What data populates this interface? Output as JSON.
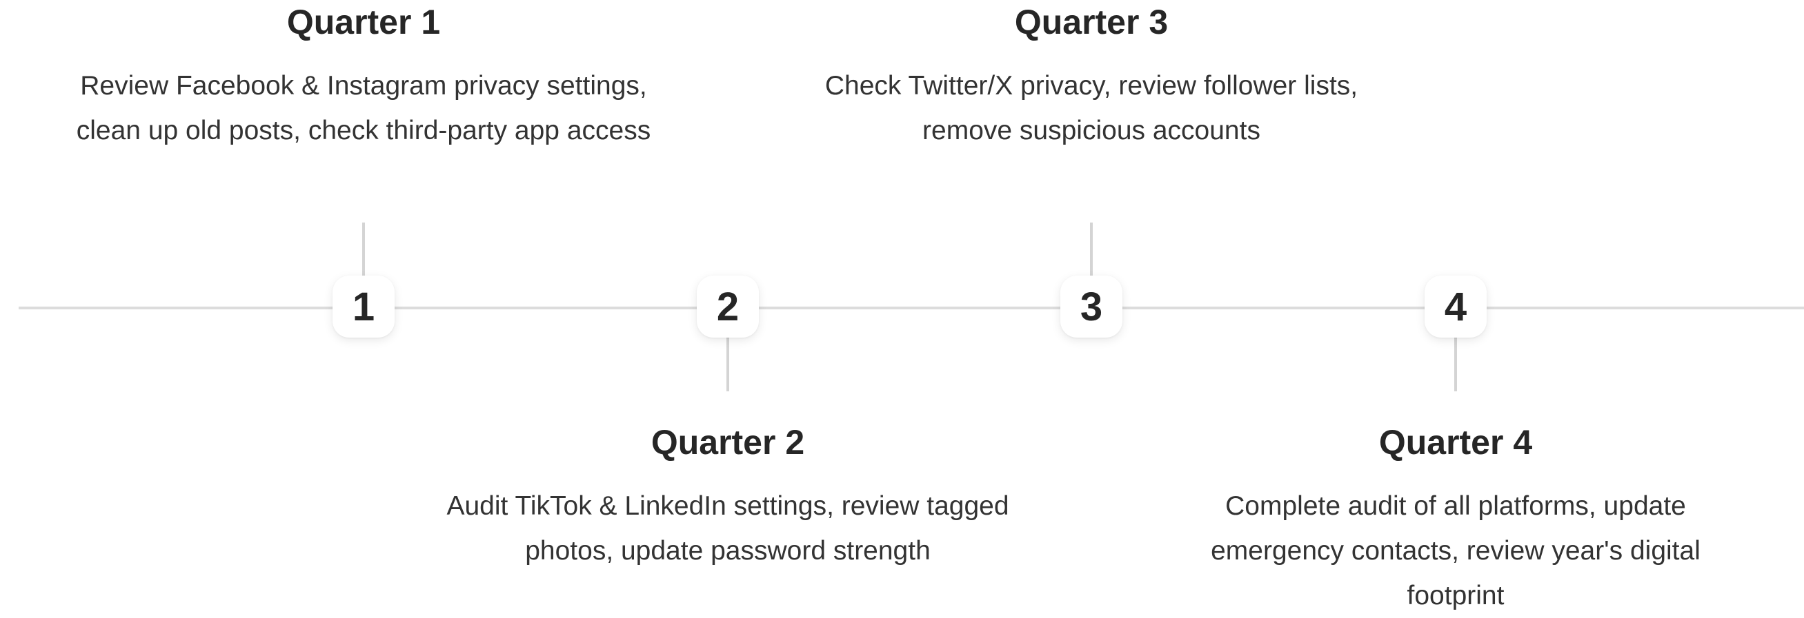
{
  "timeline": {
    "items": [
      {
        "number": "1",
        "title": "Quarter 1",
        "description": "Review Facebook & Instagram privacy settings, clean up old posts, check third-party app access"
      },
      {
        "number": "2",
        "title": "Quarter 2",
        "description": "Audit TikTok & LinkedIn settings, review tagged photos, update password strength"
      },
      {
        "number": "3",
        "title": "Quarter 3",
        "description": "Check Twitter/X privacy, review follower lists, remove suspicious accounts"
      },
      {
        "number": "4",
        "title": "Quarter 4",
        "description": "Complete audit of all platforms, update emergency contacts, review year's digital footprint"
      }
    ]
  },
  "colors": {
    "line": "#dcdcdc",
    "text": "#262626",
    "marker_bg": "#ffffff"
  }
}
